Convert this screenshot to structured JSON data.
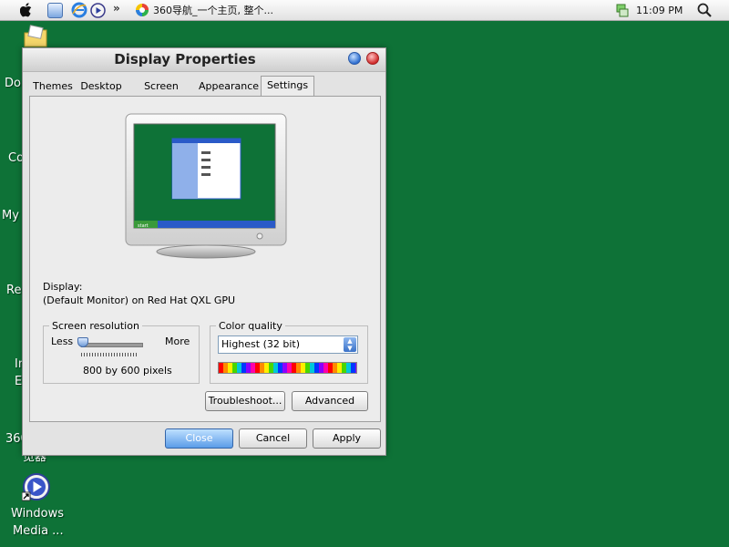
{
  "menubar": {
    "task_title": "360导航_一个主页, 整个...",
    "overflow_label": "»",
    "clock": "11:09 PM"
  },
  "desktop": {
    "icons": [
      {
        "label": "Do"
      },
      {
        "label": "Co"
      },
      {
        "label": "My"
      },
      {
        "label": "Re"
      },
      {
        "label": "In"
      },
      {
        "label": "E"
      },
      {
        "label": "360"
      },
      {
        "label": "览器"
      },
      {
        "label": "Windows"
      },
      {
        "label": "Media ..."
      }
    ]
  },
  "window": {
    "title": "Display Properties",
    "tabs": [
      {
        "label": "Themes"
      },
      {
        "label": "Desktop"
      },
      {
        "label": "Screen Saver"
      },
      {
        "label": "Appearance"
      },
      {
        "label": "Settings"
      }
    ],
    "display_label": "Display:",
    "display_value": "(Default Monitor) on Red Hat QXL GPU",
    "resolution": {
      "legend": "Screen resolution",
      "less": "Less",
      "more": "More",
      "value": "800 by 600 pixels",
      "slider_level": 0.0
    },
    "color_quality": {
      "legend": "Color quality",
      "selected": "Highest (32 bit)"
    },
    "buttons": {
      "troubleshoot": "Troubleshoot...",
      "advanced": "Advanced",
      "close": "Close",
      "cancel": "Cancel",
      "apply": "Apply"
    },
    "preview_start_label": "start"
  },
  "colors": {
    "desktop": "#0e7237",
    "accent": "#3a72c8"
  }
}
